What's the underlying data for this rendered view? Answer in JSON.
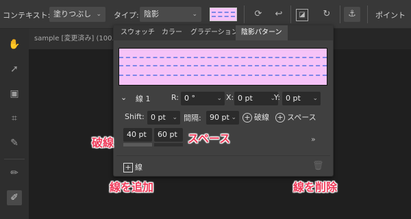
{
  "toolbar": {
    "context_label": "コンテキスト:",
    "context_value": "塗りつぶし",
    "type_label": "タイプ:",
    "type_value": "陰影",
    "point_button": "ポイント"
  },
  "document": {
    "tab_title": "sample [変更済み] (100."
  },
  "panel": {
    "tabs": [
      "スウォッチ",
      "カラー",
      "グラデーション",
      "陰影パターン"
    ],
    "active_tab": 3,
    "preview_color": "#f6c3f8",
    "line_color": "#7d86e8",
    "line_selector": "線 1",
    "r_label": "R:",
    "r_value": "0 °",
    "x_label": "X:",
    "x_value": "0 pt",
    "y_label": "Y:",
    "y_value": "0 pt",
    "shift_label": "Shift:",
    "shift_value": "0 pt",
    "spacing_label": "間隔:",
    "spacing_value": "90 pt",
    "dash_button": "破線",
    "space_button": "スペース",
    "dash_length": "40 pt",
    "gap_length": "60 pt",
    "add_line_button": "線"
  },
  "annotations": {
    "dash": "破線",
    "space": "スペース",
    "add_line": "線を追加",
    "delete_line": "線を削除",
    "color": "#ef3b5a"
  }
}
